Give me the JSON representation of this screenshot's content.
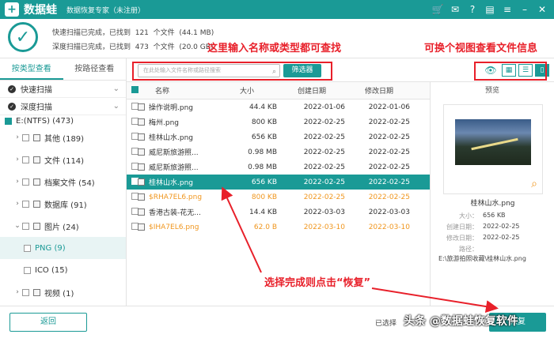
{
  "app": {
    "name": "数据蛙",
    "subtitle": "数据恢复专家（未注册）",
    "icons": [
      "cart-icon",
      "message-icon",
      "help-icon",
      "bookmark-icon",
      "menu-icon",
      "minimize-icon",
      "close-icon"
    ]
  },
  "scan": {
    "line1": "快速扫描已完成，已找到  121  个文件  (44.1 MB)",
    "line2": "深度扫描已完成，已找到  473  个文件  (20.0 GB)"
  },
  "annotations": {
    "search_hint": "这里输入名称或类型都可查找",
    "view_hint": "可换个视图查看文件信息",
    "recover_hint": "选择完成则点击“恢复”"
  },
  "left": {
    "tabs": [
      "按类型查看",
      "按路径查看"
    ],
    "scan_modes": [
      "快速扫描",
      "深度扫描"
    ],
    "tree": [
      {
        "label": "E:(NTFS) (473)"
      },
      {
        "label": "其他  (189)"
      },
      {
        "label": "文件  (114)"
      },
      {
        "label": "档案文件  (54)"
      },
      {
        "label": "数据库  (91)"
      },
      {
        "label": "图片  (24)"
      },
      {
        "label": "PNG (9)"
      },
      {
        "label": "ICO (15)"
      },
      {
        "label": "视频  (1)"
      }
    ]
  },
  "toolbar": {
    "search_placeholder": "在此处输入文件名称或路径搜索",
    "filter_label": "筛选器"
  },
  "table": {
    "headers": [
      "名称",
      "大小",
      "创建日期",
      "修改日期"
    ],
    "rows": [
      {
        "name": "操作说明.png",
        "size": "44.4 KB",
        "created": "2022-01-06",
        "modified": "2022-01-06"
      },
      {
        "name": "梅州.png",
        "size": "800 KB",
        "created": "2022-02-25",
        "modified": "2022-02-25"
      },
      {
        "name": "桂林山水.png",
        "size": "656 KB",
        "created": "2022-02-25",
        "modified": "2022-02-25"
      },
      {
        "name": "威尼斯旅游照...",
        "size": "0.98 MB",
        "created": "2022-02-25",
        "modified": "2022-02-25"
      },
      {
        "name": "威尼斯旅游照...",
        "size": "0.98 MB",
        "created": "2022-02-25",
        "modified": "2022-02-25"
      },
      {
        "name": "桂林山水.png",
        "size": "656 KB",
        "created": "2022-02-25",
        "modified": "2022-02-25"
      },
      {
        "name": "$RHA7EL6.png",
        "size": "800 KB",
        "created": "2022-02-25",
        "modified": "2022-02-25"
      },
      {
        "name": "香港古装-花无...",
        "size": "14.4 KB",
        "created": "2022-03-03",
        "modified": "2022-03-03"
      },
      {
        "name": "$IHA7EL6.png",
        "size": "62.0  B",
        "created": "2022-03-10",
        "modified": "2022-03-10"
      }
    ]
  },
  "preview": {
    "title": "预览",
    "filename": "桂林山水.png",
    "size_label": "大小：",
    "size": "656 KB",
    "created_label": "创建日期：",
    "created": "2022-02-25",
    "modified_label": "修改日期：",
    "modified": "2022-02-25",
    "path_label": "路径：",
    "path": "E:\\旅游拍照收藏\\桂林山水.png"
  },
  "footer": {
    "back_label": "返回",
    "selected_label": "已选择",
    "recover_label": "恢复"
  },
  "watermark": "头条 @数据蛙恢复软件",
  "colors": {
    "accent": "#1a9a96",
    "annotation": "#e8202a",
    "orange": "#f0961e"
  }
}
